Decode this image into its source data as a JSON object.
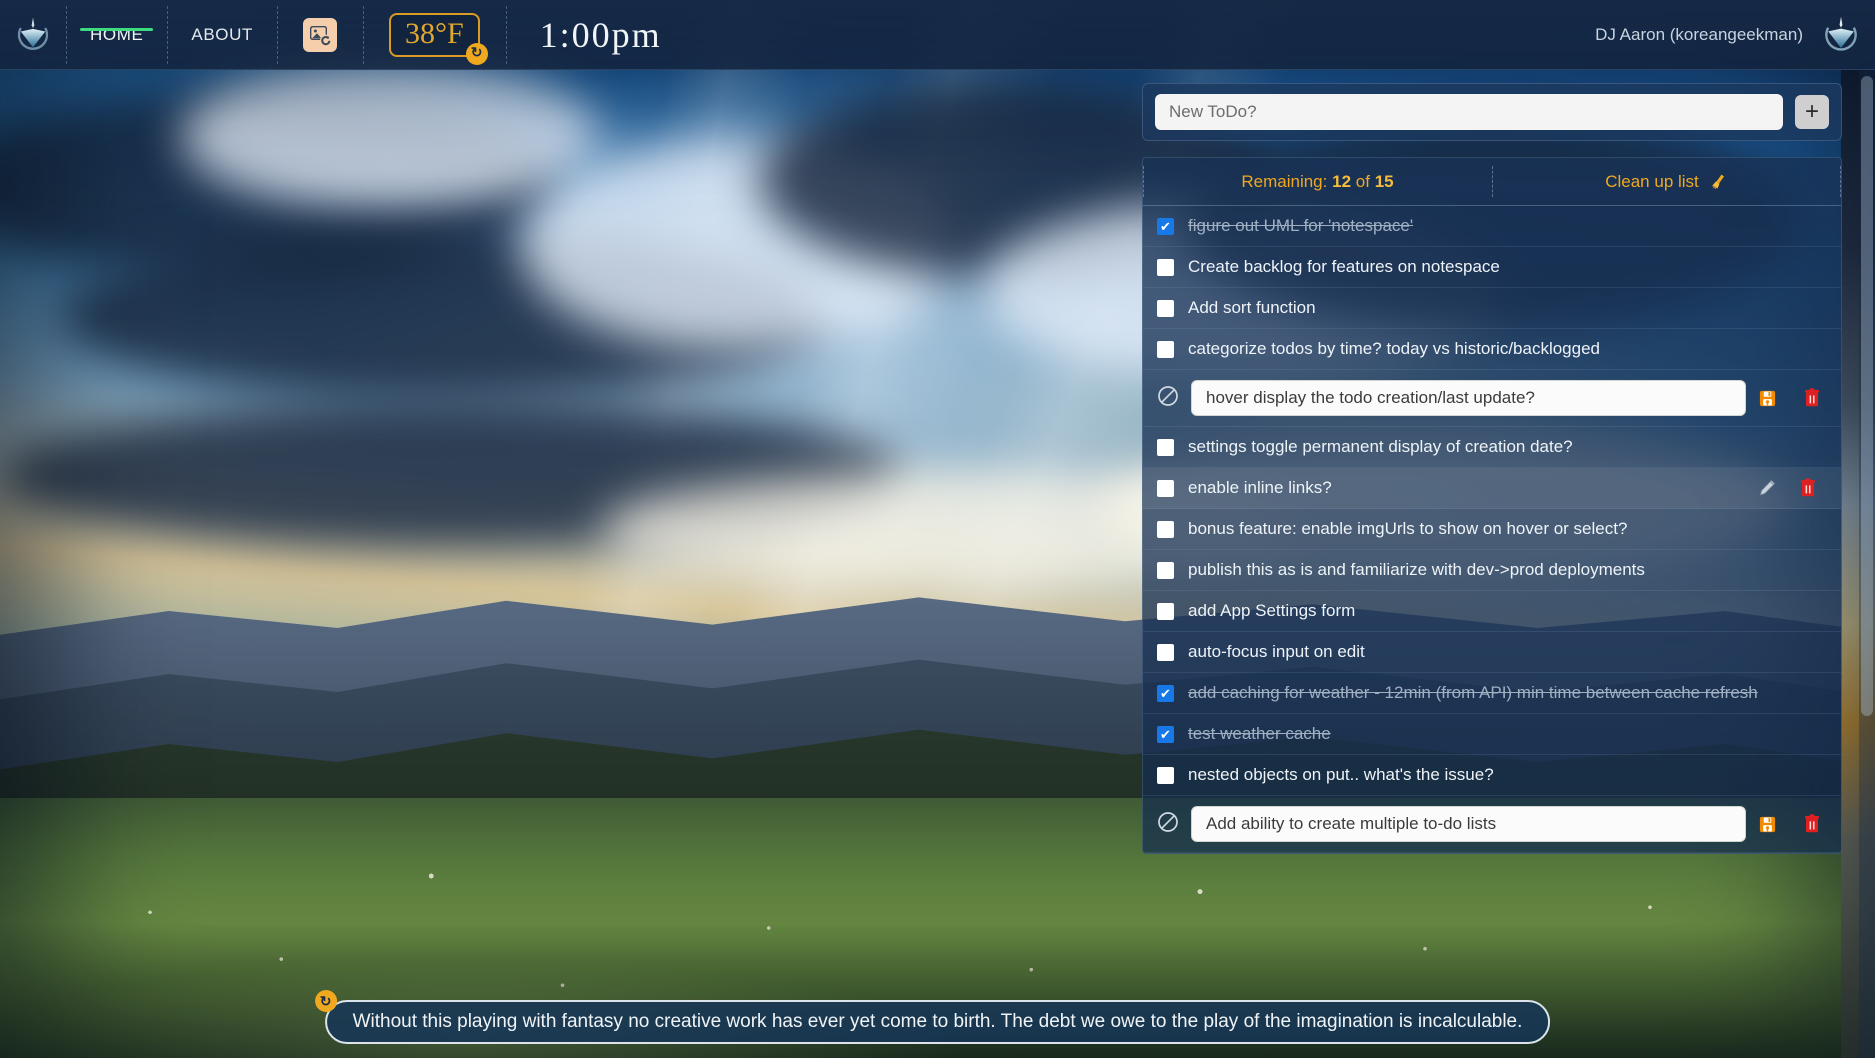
{
  "header": {
    "logo_left": "notespace-logo",
    "logo_right": "notespace-logo",
    "nav": [
      {
        "label": "HOME",
        "active": true
      },
      {
        "label": "ABOUT",
        "active": false
      }
    ],
    "image_refresh_icon": "image-refresh-icon",
    "weather": {
      "value": "38°F",
      "refresh_icon": "refresh-icon"
    },
    "clock": "1:00pm",
    "user": "DJ Aaron (koreangeekman)"
  },
  "todo": {
    "new_todo_placeholder": "New ToDo?",
    "new_todo_value": "",
    "add_button_label": "+",
    "remaining_label": "Remaining:",
    "remaining_count": "12",
    "remaining_of": "of",
    "remaining_total": "15",
    "cleanup_label": "Clean up list",
    "cleanup_icon": "broom-icon",
    "items": [
      {
        "text": "figure out UML for 'notespace'",
        "done": true,
        "mode": "view",
        "hovered": false
      },
      {
        "text": "Create backlog for features on notespace",
        "done": false,
        "mode": "view",
        "hovered": false
      },
      {
        "text": "Add sort function",
        "done": false,
        "mode": "view",
        "hovered": false
      },
      {
        "text": "categorize todos by time? today vs historic/backlogged",
        "done": false,
        "mode": "view",
        "hovered": false
      },
      {
        "text": "hover display the todo creation/last update?",
        "done": false,
        "mode": "edit",
        "hovered": false
      },
      {
        "text": "settings toggle permanent display of creation date?",
        "done": false,
        "mode": "view",
        "hovered": false
      },
      {
        "text": "enable inline links?",
        "done": false,
        "mode": "view",
        "hovered": true
      },
      {
        "text": "bonus feature: enable imgUrls to show on hover or select?",
        "done": false,
        "mode": "view",
        "hovered": false
      },
      {
        "text": "publish this as is and familiarize with dev->prod deployments",
        "done": false,
        "mode": "view",
        "hovered": false
      },
      {
        "text": "add App Settings form",
        "done": false,
        "mode": "view",
        "hovered": false
      },
      {
        "text": "auto-focus input on edit",
        "done": false,
        "mode": "view",
        "hovered": false
      },
      {
        "text": "add caching for weather - 12min (from API) min time between cache refresh",
        "done": true,
        "mode": "view",
        "hovered": false
      },
      {
        "text": "test weather cache",
        "done": true,
        "mode": "view",
        "hovered": false
      },
      {
        "text": "nested objects on put.. what's the issue?",
        "done": false,
        "mode": "view",
        "hovered": false
      },
      {
        "text": "Add ability to create multiple to-do lists",
        "done": false,
        "mode": "edit",
        "hovered": false
      }
    ]
  },
  "quote": {
    "text": "Without this playing with fantasy no creative work has ever yet come to birth. The debt we owe to the play of the imagination is incalculable.",
    "refresh_icon": "refresh-icon"
  },
  "colors": {
    "accent_orange": "#f0a81f",
    "weather_gold": "#e0a72e",
    "active_nav_green": "#3ddc7f",
    "checkbox_blue": "#1778e8",
    "delete_red": "#e02020",
    "save_orange": "#f08a00",
    "panel_blue": "#1b385e"
  }
}
